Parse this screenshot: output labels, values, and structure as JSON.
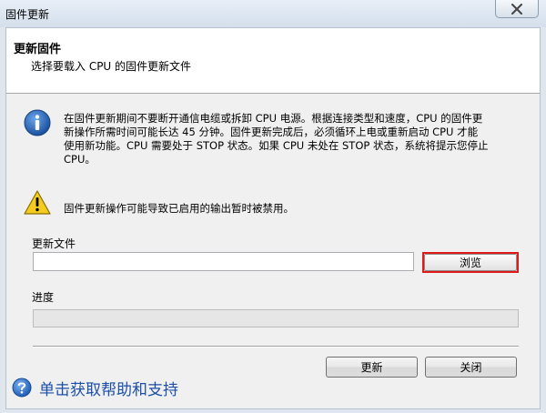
{
  "window": {
    "title": "固件更新"
  },
  "header": {
    "title": "更新固件",
    "subtitle": "选择要载入 CPU 的固件更新文件"
  },
  "info": {
    "lines": [
      "在固件更新期间不要断开通信电缆或拆卸 CPU 电源。根据连接类型和速度，CPU 的固件更",
      "新操作所需时间可能长达 45 分钟。固件更新完成后，必须循环上电或重新启动 CPU 才能",
      "使用新功能。CPU 需要处于 STOP 状态。如果 CPU 未处在 STOP 状态，系统将提示您停止",
      "CPU。"
    ]
  },
  "warning": {
    "text": "固件更新操作可能导致已启用的输出暂时被禁用。"
  },
  "update_file": {
    "label": "更新文件",
    "value": "",
    "browse_label": "浏览"
  },
  "progress": {
    "label": "进度",
    "fraction": 0
  },
  "buttons": {
    "update_label": "更新",
    "close_label": "关闭"
  },
  "help": {
    "text": "单击获取帮助和支持"
  },
  "colors": {
    "highlight": "#e01a1a",
    "link": "#1c4fa8",
    "info_icon": "#1f5fb7",
    "warning_icon": "#f4cc1f"
  }
}
